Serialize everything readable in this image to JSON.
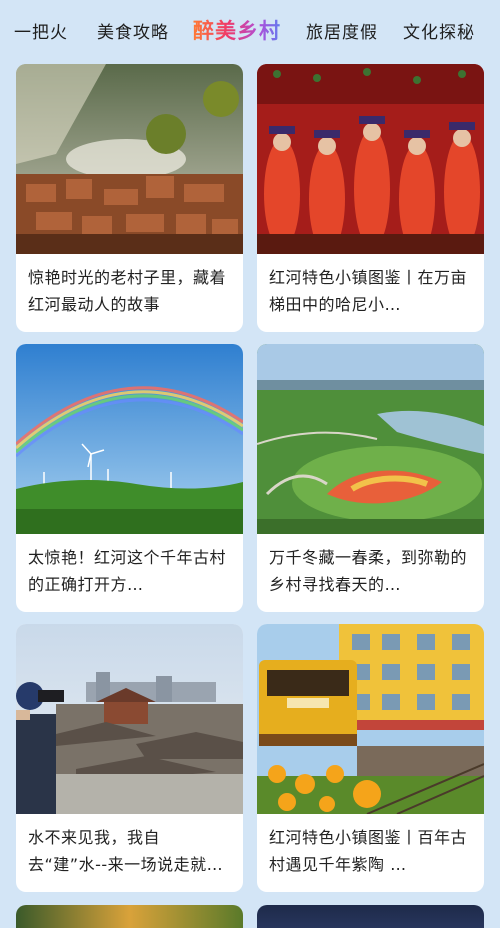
{
  "tabs": [
    {
      "label": "一把火"
    },
    {
      "label": "美食攻略"
    },
    {
      "label": "醉美乡村"
    },
    {
      "label": "旅居度假"
    },
    {
      "label": "文化探秘"
    }
  ],
  "active_tab": "醉美乡村",
  "cards": [
    {
      "title": "惊艳时光的老村子里，藏着红河最动人的故事",
      "image": "old-village-photo"
    },
    {
      "title": "红河特色小镇图鉴丨在万亩梯田中的哈尼小…",
      "image": "folk-dancers-photo"
    },
    {
      "title": "太惊艳！红河这个千年古村的正确打开方…",
      "image": "rainbow-wind-turbines-photo"
    },
    {
      "title": "万千冬藏一春柔，到弥勒的乡村寻找春天的…",
      "image": "flower-field-lake-photo"
    },
    {
      "title": "水不来见我，我自去“建”水--来一场说走就走的…",
      "image": "photographer-rooftops-photo"
    },
    {
      "title": "红河特色小镇图鉴丨百年古村遇见千年紫陶 …",
      "image": "yellow-train-building-photo"
    }
  ]
}
